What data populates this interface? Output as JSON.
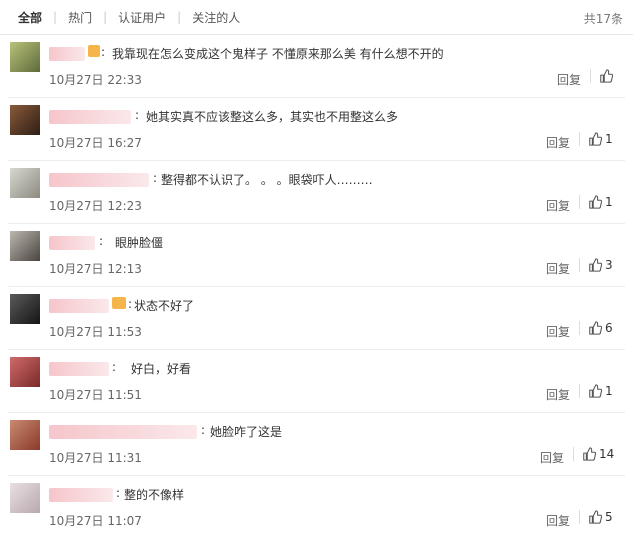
{
  "tabs": [
    {
      "label": "全部",
      "active": true
    },
    {
      "label": "热门",
      "active": false
    },
    {
      "label": "认证用户",
      "active": false
    },
    {
      "label": "关注的人",
      "active": false
    }
  ],
  "total": "共17条",
  "reply_label": "回复",
  "comments": [
    {
      "text": "我靠现在怎么变成这个鬼样子 不懂原来那么美 有什么想不开的",
      "time": "10月27日 22:33",
      "likes": ""
    },
    {
      "text": "她其实真不应该整这么多，其实也不用整这么多",
      "time": "10月27日 16:27",
      "likes": "1"
    },
    {
      "text": "整得都不认识了。 。 。眼袋吓人………",
      "time": "10月27日 12:23",
      "likes": "1"
    },
    {
      "text": "眼肿脸僵",
      "time": "10月27日 12:13",
      "likes": "3"
    },
    {
      "text": "状态不好了",
      "time": "10月27日 11:53",
      "likes": "6"
    },
    {
      "text": "好白，好看",
      "time": "10月27日 11:51",
      "likes": "1"
    },
    {
      "text": "她脸咋了这是",
      "time": "10月27日 11:31",
      "likes": "14"
    },
    {
      "text": "整的不像样",
      "time": "10月27日 11:07",
      "likes": "5"
    }
  ],
  "colors": {
    "divider": "#ececec",
    "badge": "#f5b54a",
    "blur_name": "#eea0a8"
  }
}
